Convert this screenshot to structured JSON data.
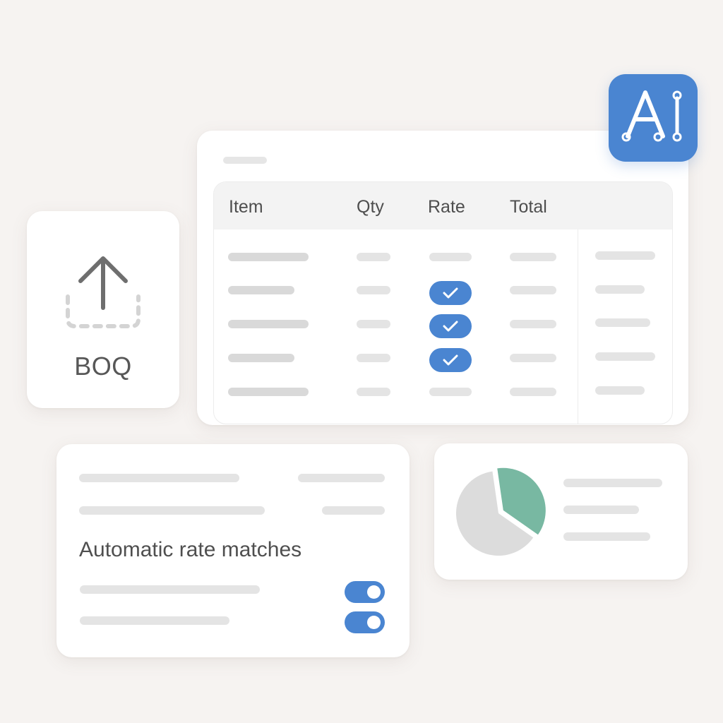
{
  "upload": {
    "label": "BOQ",
    "icon": "upload-icon"
  },
  "ai_badge": {
    "label": "AI",
    "icon": "ai-circuit-icon",
    "color": "#4a85d1"
  },
  "table": {
    "columns": [
      "Item",
      "Qty",
      "Rate",
      "Total"
    ],
    "rows": [
      {
        "rate_checked": false
      },
      {
        "rate_checked": true
      },
      {
        "rate_checked": true
      },
      {
        "rate_checked": true
      },
      {
        "rate_checked": false
      }
    ],
    "accent": "#4a85d1"
  },
  "settings": {
    "title": "Automatic rate matches",
    "toggles": [
      {
        "on": true
      },
      {
        "on": true
      }
    ]
  },
  "chart_data": {
    "type": "pie",
    "slices": [
      {
        "value": 63,
        "color": "#dcdcdc"
      },
      {
        "value": 37,
        "color": "#78b8a2"
      }
    ]
  }
}
